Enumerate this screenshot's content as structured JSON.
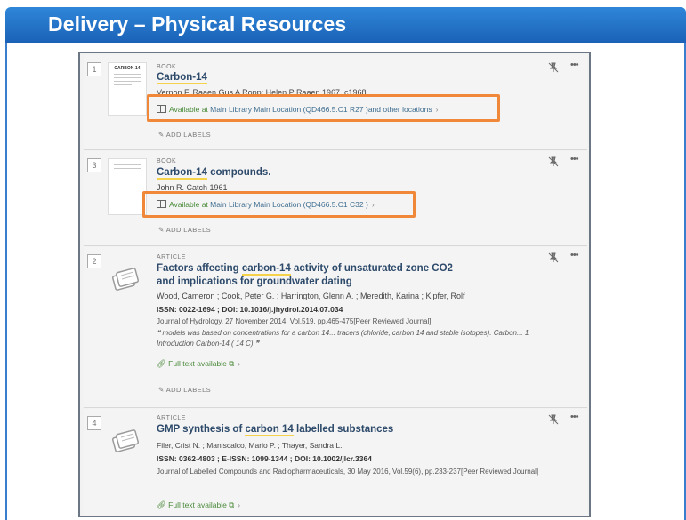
{
  "slide": {
    "title": "Delivery – Physical Resources"
  },
  "results": [
    {
      "number": "1",
      "type": "BOOK",
      "title_hl": "Carbon-14",
      "title_rest": "",
      "thumb_title": "CARBON-14",
      "byline": "Vernon F. Raaen Gus A Ropp; Helen P Raaen 1967, c1968",
      "availability": {
        "prefix": "Available at",
        "location": "Main Library  Main Location (QD466.5.C1 R27 )",
        "suffix": "and other locations"
      },
      "add_labels": "ADD LABELS"
    },
    {
      "number": "3",
      "type": "BOOK",
      "title_hl": "Carbon-14",
      "title_rest": " compounds.",
      "byline": "John R. Catch 1961",
      "availability": {
        "prefix": "Available at",
        "location": "Main Library  Main Location (QD466.5.C1 C32 )",
        "suffix": ""
      },
      "add_labels": "ADD LABELS"
    },
    {
      "number": "2",
      "type": "ARTICLE",
      "title_pre": "Factors affecting ",
      "title_hl": "carbon-14",
      "title_rest": " activity of unsaturated zone CO2 and implications for groundwater dating",
      "byline": "Wood, Cameron ; Cook, Peter G. ; Harrington, Glenn A. ; Meredith, Karina ; Kipfer, Rolf",
      "ids": "ISSN: 0022-1694 ; DOI: 10.1016/j.jhydrol.2014.07.034",
      "source": "Journal of Hydrology, 27 November 2014, Vol.519, pp.465-475[Peer Reviewed Journal]",
      "snippet": "models was based on concentrations for a carbon 14... tracers (chloride, carbon 14 and stable isotopes). Carbon... 1 Introduction Carbon-14 ( 14 C)",
      "full_text": "Full text available",
      "add_labels": "ADD LABELS"
    },
    {
      "number": "4",
      "type": "ARTICLE",
      "title_pre": "GMP synthesis of ",
      "title_hl": "carbon 14",
      "title_rest": " labelled substances",
      "byline": "Filer, Crist N. ; Maniscalco, Mario P. ; Thayer, Sandra L.",
      "ids": "ISSN: 0362-4803 ; E-ISSN: 1099-1344 ; DOI: 10.1002/jlcr.3364",
      "source": "Journal of Labelled Compounds and Radiopharmaceuticals, 30 May 2016, Vol.59(6), pp.233-237[Peer Reviewed Journal]",
      "full_text": "Full text available"
    }
  ],
  "icons": {
    "pin": "pin-icon",
    "more": "more-options-icon",
    "availability": "book-shelf-icon",
    "label": "tag-icon",
    "link": "link-icon",
    "external": "external-link-icon"
  },
  "colors": {
    "header": "#1f6fc9",
    "highlight_box": "#f0883a",
    "available": "#4a8a3a",
    "title": "#2d4a6b"
  }
}
